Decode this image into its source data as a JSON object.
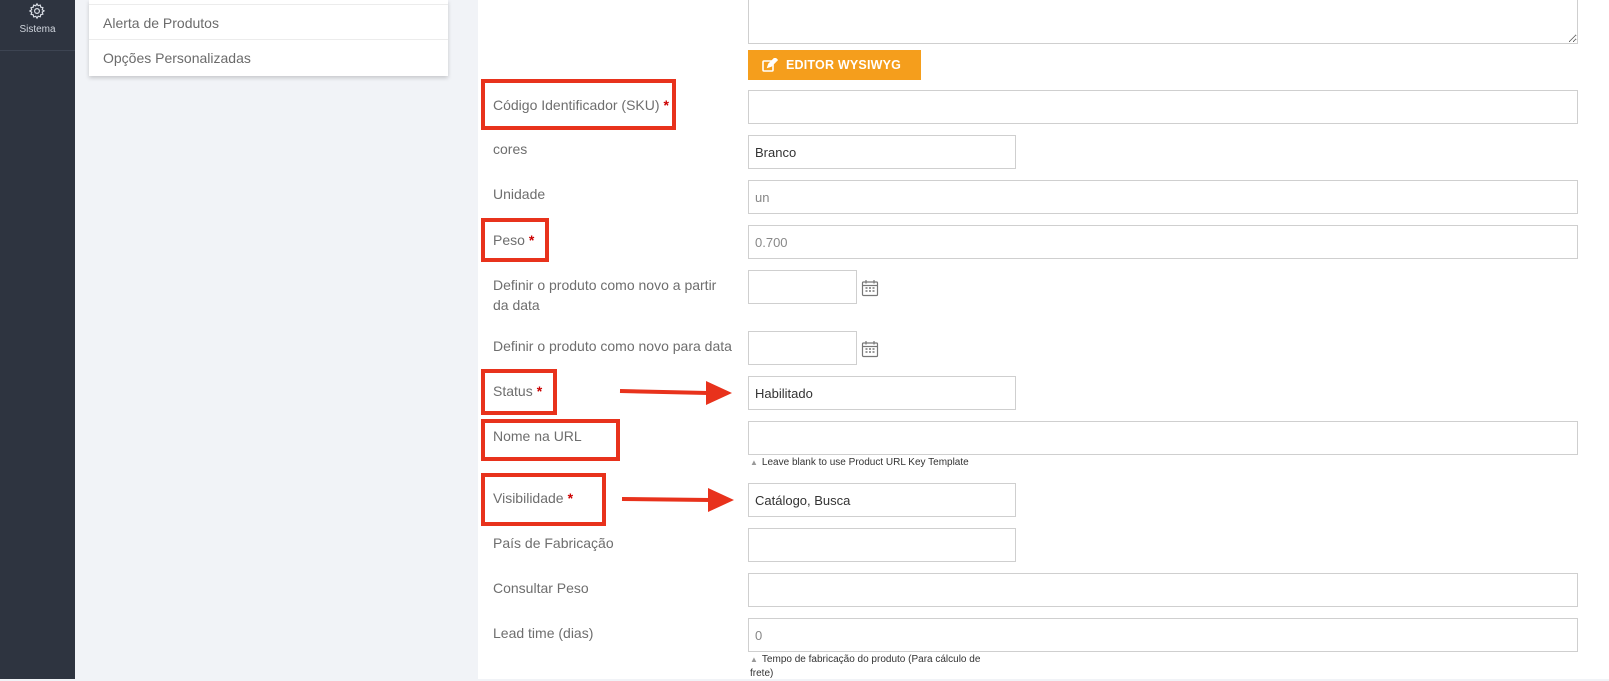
{
  "sidebar": {
    "system_item": {
      "label": "Sistema",
      "icon": "gear-icon"
    }
  },
  "menu": {
    "items": [
      {
        "label": "Alerta de Produtos"
      },
      {
        "label": "Opções Personalizadas"
      }
    ]
  },
  "editor": {
    "button_label": "EDITOR WYSIWYG",
    "icon": "edit-icon",
    "button_color": "#f59e1c"
  },
  "form": {
    "sku": {
      "label": "Código Identificador (SKU)",
      "required": "*",
      "value": ""
    },
    "cores": {
      "label": "cores",
      "value": "Branco"
    },
    "unidade": {
      "label": "Unidade",
      "value": "un"
    },
    "peso": {
      "label": "Peso",
      "required": "*",
      "value": "0.700"
    },
    "novo_de": {
      "label": "Definir o produto como novo a partir da data",
      "value": "",
      "icon": "calendar-icon"
    },
    "novo_ate": {
      "label": "Definir o produto como novo para data",
      "value": "",
      "icon": "calendar-icon"
    },
    "status": {
      "label": "Status",
      "required": "*",
      "value": "Habilitado"
    },
    "url_key": {
      "label": "Nome na URL",
      "value": "",
      "hint": "Leave blank to use Product URL Key Template"
    },
    "visibilidade": {
      "label": "Visibilidade",
      "required": "*",
      "value": "Catálogo, Busca"
    },
    "pais": {
      "label": "País de Fabricação",
      "value": ""
    },
    "consultar_peso": {
      "label": "Consultar Peso",
      "value": ""
    },
    "lead_time": {
      "label": "Lead time (dias)",
      "value": "0",
      "hint": "Tempo de fabricação do produto (Para cálculo de frete)"
    }
  },
  "colors": {
    "annotation_red": "#e8321c",
    "required_red": "#cc0000",
    "sidebar_bg": "#2e3440"
  }
}
